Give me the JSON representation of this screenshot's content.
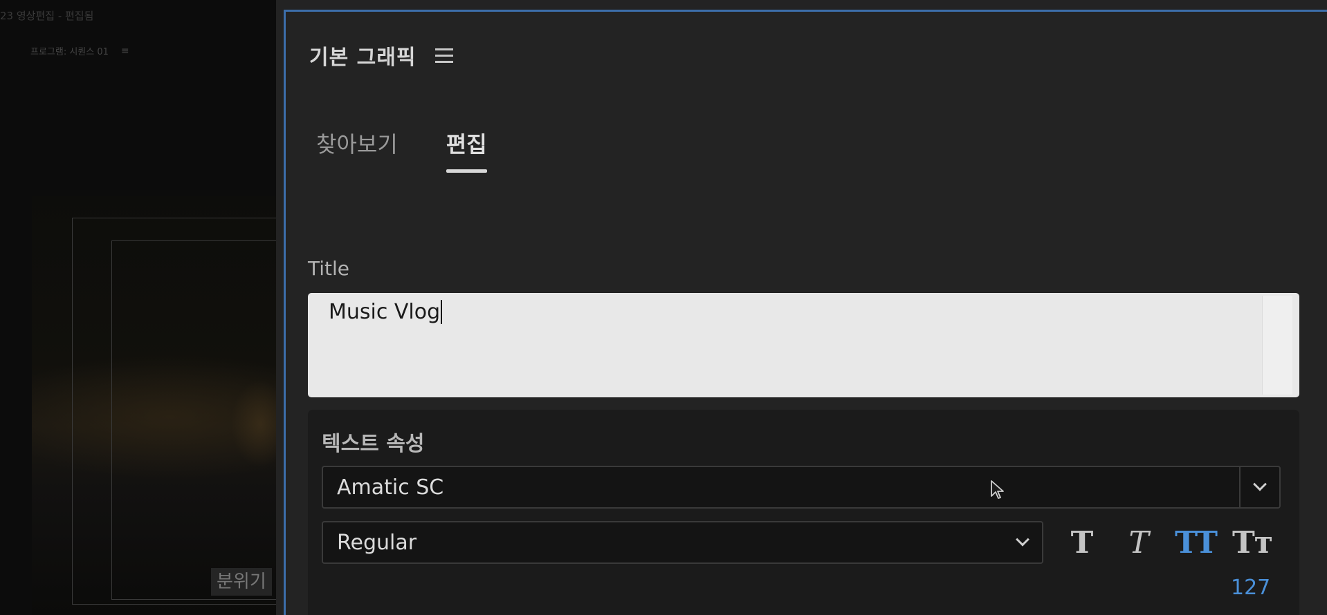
{
  "background": {
    "window_title": "23 영상편집 - 편집됨",
    "program_tab": "프로그램: 시퀀스 01",
    "caption_text": "분위기"
  },
  "panel": {
    "title": "기본 그래픽",
    "tabs": [
      {
        "label": "찾아보기",
        "active": false
      },
      {
        "label": "편집",
        "active": true
      }
    ],
    "field_label": "Title",
    "title_value": "Music Vlog",
    "text_properties": {
      "heading": "텍스트 속성",
      "font": "Amatic SC",
      "font_style": "Regular",
      "type_buttons": [
        "T",
        "T",
        "TT",
        "Tт"
      ],
      "font_size": "127"
    },
    "accent_color": "#4a90d9",
    "border_color": "#3c6eaa"
  }
}
